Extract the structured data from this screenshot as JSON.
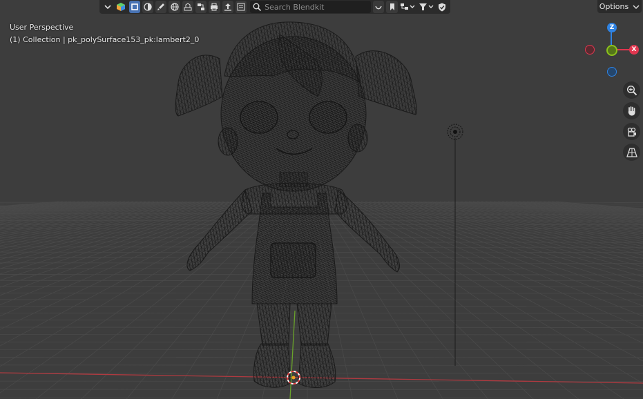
{
  "toolbar": {
    "search_placeholder": "Search Blendkit",
    "buttons": [
      "collapse-menu",
      "blenderkit-logo",
      "models",
      "materials",
      "brushes",
      "hdr",
      "scenes",
      "nodegroups",
      "printables",
      "upload",
      "tools"
    ]
  },
  "options": {
    "label": "Options"
  },
  "viewport": {
    "view_name": "User Perspective",
    "collection_info": "(1) Collection | pk_polySurface153_pk:lambert2_0"
  },
  "gizmo": {
    "z_label": "Z",
    "x_label": "X",
    "colors": {
      "x": "#e0364f",
      "y": "#8bc21c",
      "z": "#2f83e3"
    }
  },
  "nav_tools": [
    "zoom-icon",
    "hand-pan-icon",
    "camera-view-icon",
    "perspective-grid-icon"
  ],
  "colors": {
    "background": "#3d3d3d",
    "grid": "#4a4a4a",
    "x_axis": "#b03a40",
    "y_axis": "#6aa32b",
    "header": "#2b2b2b"
  }
}
